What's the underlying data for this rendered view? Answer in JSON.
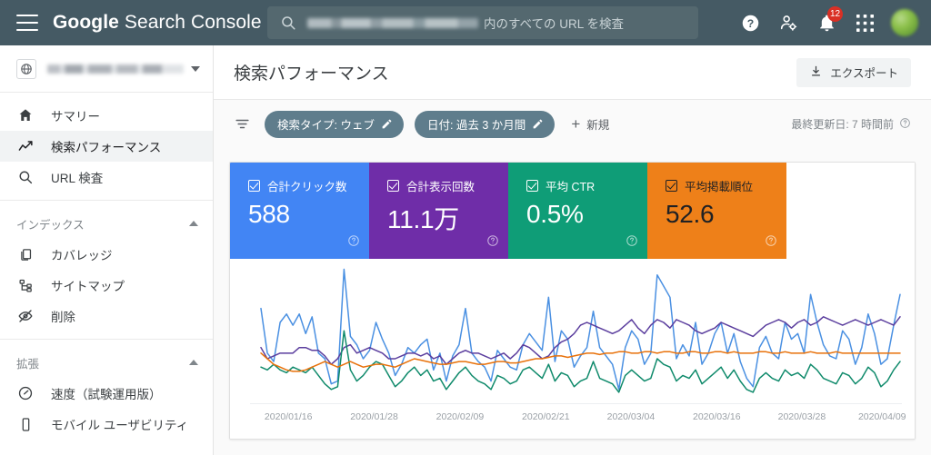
{
  "topbar": {
    "menu_icon": "hamburger-icon",
    "brand_bold": "Google",
    "brand_rest": " Search Console",
    "search": {
      "icon": "search-icon",
      "redacted_property": "",
      "suffix_text": "内のすべての URL を検査",
      "placeholder": "内のすべての URL を検査"
    },
    "icons": [
      {
        "name": "help-icon",
        "label": "ヘルプ"
      },
      {
        "name": "account-settings-icon",
        "label": "アカウント設定"
      },
      {
        "name": "notifications-icon",
        "label": "通知",
        "badge": "12"
      },
      {
        "name": "apps-grid-icon",
        "label": "Google アプリ"
      },
      {
        "name": "avatar",
        "label": "アカウント"
      }
    ]
  },
  "sidebar": {
    "property_selector": {
      "icon": "globe-icon",
      "name_redacted": "",
      "caret": "chevron-down-icon"
    },
    "groups": [
      {
        "items": [
          {
            "icon": "home-icon",
            "label": "サマリー",
            "active": false
          },
          {
            "icon": "trending-up-icon",
            "label": "検索パフォーマンス",
            "active": true
          },
          {
            "icon": "search-icon",
            "label": "URL 検査",
            "active": false
          }
        ]
      },
      {
        "header": "インデックス",
        "collapse_icon": "chevron-up-icon",
        "items": [
          {
            "icon": "pages-icon",
            "label": "カバレッジ",
            "active": false
          },
          {
            "icon": "sitemap-icon",
            "label": "サイトマップ",
            "active": false
          },
          {
            "icon": "eye-off-icon",
            "label": "削除",
            "active": false
          }
        ]
      },
      {
        "header": "拡張",
        "collapse_icon": "chevron-up-icon",
        "items": [
          {
            "icon": "speed-gauge-icon",
            "label": "速度（試験運用版）",
            "active": false
          },
          {
            "icon": "mobile-phone-icon",
            "label": "モバイル ユーザビリティ",
            "active": false
          }
        ]
      }
    ]
  },
  "main": {
    "page_title": "検索パフォーマンス",
    "export_button": {
      "icon": "download-icon",
      "label": "エクスポート"
    },
    "filter_bar": {
      "filter_icon": "filter-list-icon",
      "chips": [
        {
          "label": "検索タイプ: ウェブ",
          "edit_icon": "pencil-icon"
        },
        {
          "label": "日付: 過去 3 か月間",
          "edit_icon": "pencil-icon"
        }
      ],
      "new_filter": {
        "plus": "+",
        "label": "新規"
      },
      "last_updated": {
        "text": "最終更新日: 7 時間前",
        "icon": "help-circle-icon"
      }
    },
    "metrics": [
      {
        "key": "clicks",
        "label": "合計クリック数",
        "value": "588",
        "color": "#4285f4",
        "checked": true,
        "help_icon": "help-circle-icon"
      },
      {
        "key": "impressions",
        "label": "合計表示回数",
        "value": "11.1万",
        "color": "#6f2da8",
        "checked": true,
        "help_icon": "help-circle-icon"
      },
      {
        "key": "ctr",
        "label": "平均 CTR",
        "value": "0.5%",
        "color": "#0f9d77",
        "checked": true,
        "help_icon": "help-circle-icon"
      },
      {
        "key": "position",
        "label": "平均掲載順位",
        "value": "52.6",
        "color": "#ee8019",
        "checked": true,
        "help_icon": "help-circle-icon"
      }
    ]
  },
  "chart_data": {
    "type": "line",
    "title": "検索パフォーマンス",
    "xlabel": "",
    "ylabel": "",
    "grid": false,
    "legend": "metric-cards-above",
    "x_tick_labels": [
      "2020/01/16",
      "2020/01/28",
      "2020/02/09",
      "2020/02/21",
      "2020/03/04",
      "2020/03/16",
      "2020/03/28",
      "2020/04/09"
    ],
    "x_tick_positions_pct": [
      8.5,
      21.0,
      33.5,
      46.0,
      58.4,
      70.9,
      83.3,
      95.0
    ],
    "series": [
      {
        "name": "合計クリック数",
        "color": "#4a90e2",
        "total": 588,
        "values": [
          62,
          30,
          24,
          52,
          58,
          50,
          58,
          44,
          56,
          30,
          26,
          8,
          10,
          90,
          42,
          36,
          26,
          32,
          52,
          40,
          30,
          14,
          22,
          34,
          30,
          36,
          40,
          18,
          30,
          10,
          28,
          36,
          62,
          30,
          24,
          20,
          10,
          32,
          26,
          20,
          18,
          36,
          44,
          38,
          32,
          70,
          24,
          46,
          40,
          20,
          28,
          34,
          60,
          34,
          28,
          22,
          4,
          34,
          46,
          40,
          22,
          30,
          86,
          78,
          70,
          26,
          36,
          28,
          52,
          22,
          30,
          44,
          52,
          30,
          44,
          24,
          12,
          6,
          34,
          42,
          30,
          26,
          52,
          40,
          44,
          30,
          72,
          52,
          36,
          28,
          26,
          46,
          40,
          22,
          34,
          58,
          44,
          22,
          26,
          50,
          72
        ]
      },
      {
        "name": "合計表示回数",
        "color": "#5b3e9e",
        "total": 111000,
        "values": [
          34,
          26,
          28,
          30,
          30,
          30,
          34,
          34,
          32,
          32,
          28,
          22,
          26,
          34,
          36,
          30,
          32,
          34,
          32,
          30,
          26,
          26,
          28,
          30,
          30,
          28,
          30,
          26,
          28,
          22,
          26,
          30,
          32,
          30,
          30,
          28,
          26,
          28,
          30,
          26,
          30,
          36,
          34,
          30,
          26,
          28,
          34,
          38,
          40,
          44,
          50,
          52,
          50,
          48,
          46,
          44,
          46,
          50,
          54,
          48,
          44,
          50,
          54,
          52,
          48,
          54,
          52,
          50,
          46,
          44,
          46,
          48,
          52,
          50,
          48,
          46,
          44,
          42,
          46,
          50,
          52,
          54,
          52,
          48,
          52,
          54,
          50,
          52,
          56,
          54,
          52,
          50,
          52,
          54,
          52,
          50,
          52,
          54,
          52,
          50,
          56
        ]
      },
      {
        "name": "平均 CTR",
        "color": "#0f8a6b",
        "value_pct": 0.5,
        "values": [
          20,
          18,
          22,
          18,
          16,
          20,
          18,
          16,
          20,
          14,
          8,
          4,
          6,
          46,
          18,
          10,
          14,
          20,
          24,
          22,
          14,
          6,
          10,
          16,
          20,
          14,
          18,
          10,
          12,
          4,
          10,
          16,
          20,
          14,
          10,
          8,
          4,
          14,
          12,
          8,
          10,
          18,
          20,
          16,
          12,
          22,
          10,
          16,
          14,
          6,
          10,
          12,
          24,
          12,
          10,
          8,
          2,
          14,
          18,
          14,
          10,
          12,
          26,
          22,
          20,
          10,
          14,
          12,
          18,
          8,
          12,
          16,
          20,
          12,
          18,
          10,
          4,
          2,
          12,
          16,
          12,
          10,
          18,
          14,
          16,
          12,
          22,
          18,
          12,
          10,
          8,
          16,
          14,
          8,
          12,
          20,
          16,
          6,
          10,
          18,
          24
        ]
      },
      {
        "name": "平均掲載順位",
        "color": "#e8710a",
        "value": 52.6,
        "values": [
          30,
          26,
          22,
          20,
          18,
          17,
          17,
          18,
          20,
          22,
          24,
          22,
          20,
          22,
          24,
          22,
          20,
          21,
          22,
          22,
          21,
          20,
          22,
          24,
          26,
          25,
          24,
          23,
          22,
          22,
          23,
          24,
          24,
          23,
          22,
          22,
          23,
          24,
          24,
          23,
          23,
          24,
          25,
          26,
          26,
          27,
          28,
          28,
          27,
          28,
          29,
          30,
          30,
          29,
          30,
          30,
          31,
          31,
          30,
          30,
          31,
          31,
          30,
          31,
          31,
          30,
          30,
          31,
          31,
          30,
          30,
          31,
          31,
          30,
          31,
          30,
          30,
          30,
          31,
          31,
          30,
          30,
          31,
          30,
          30,
          30,
          31,
          30,
          30,
          30,
          31,
          30,
          30,
          30,
          30,
          30,
          30,
          30,
          30,
          30,
          30
        ]
      }
    ]
  }
}
